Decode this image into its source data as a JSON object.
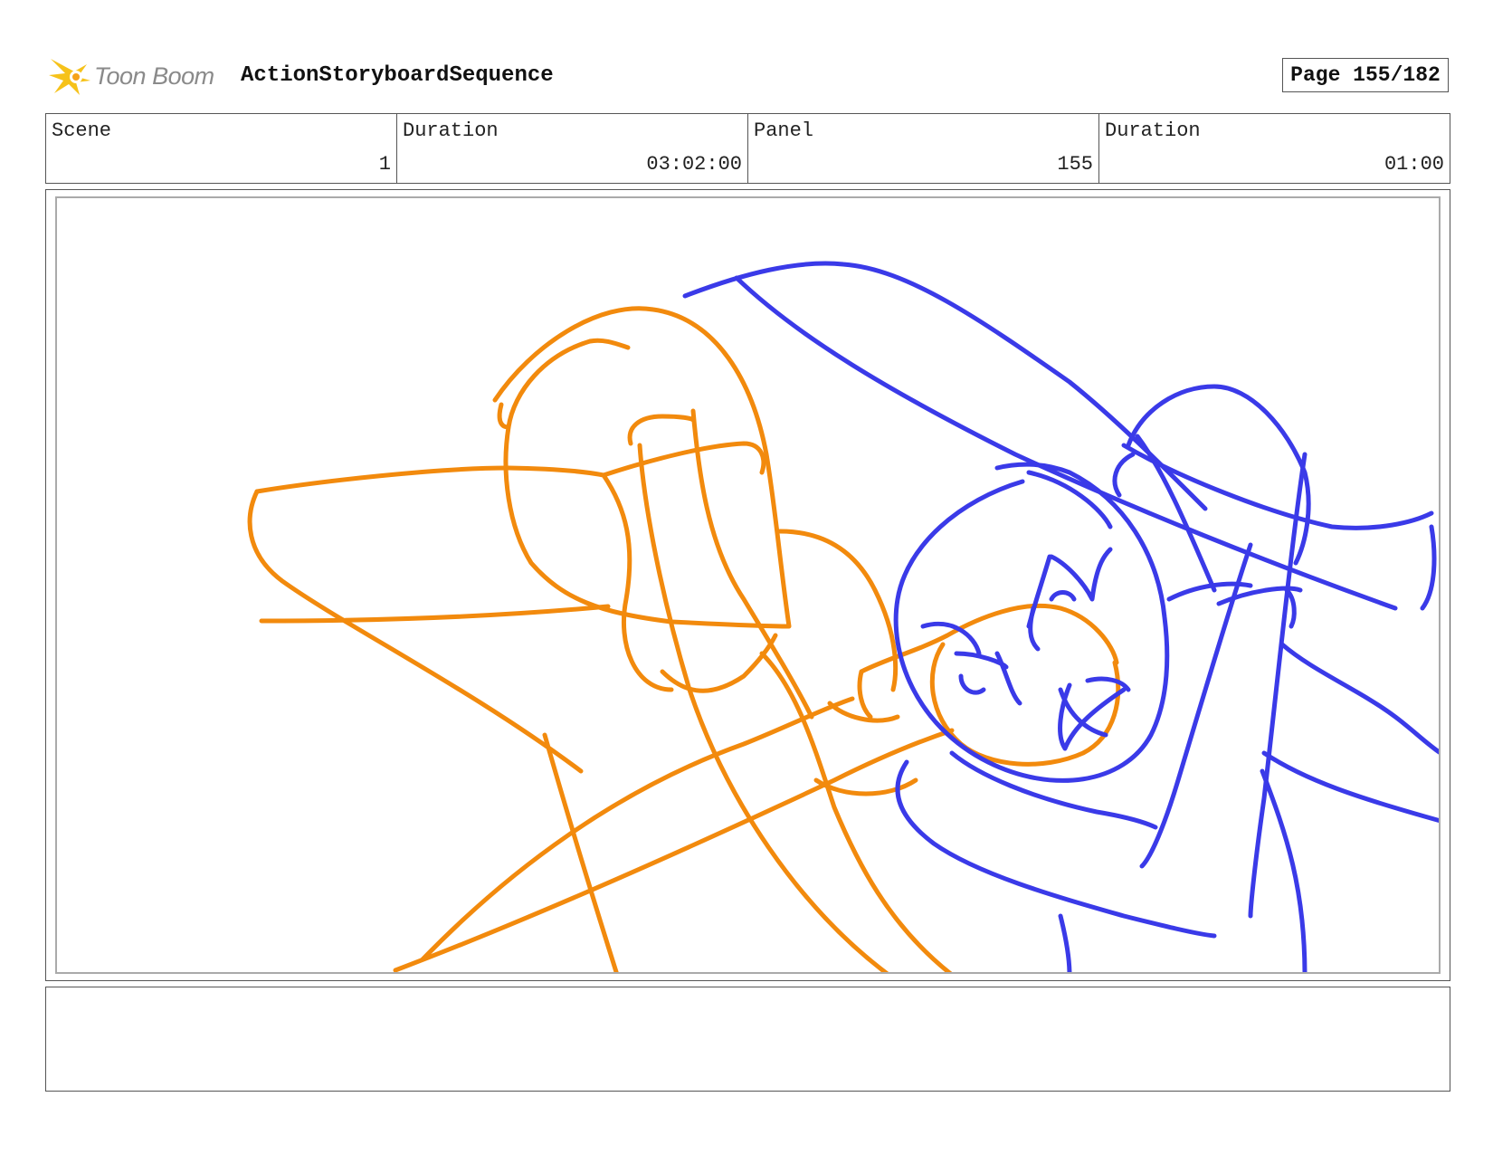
{
  "header": {
    "logo_text": "Toon Boom",
    "logo_icon": "toon-boom-burst-icon",
    "sequence_title": "ActionStoryboardSequence",
    "page_label": "Page 155/182"
  },
  "info": {
    "scene_label": "Scene",
    "scene_value": "1",
    "scene_duration_label": "Duration",
    "scene_duration_value": "03:02:00",
    "panel_label": "Panel",
    "panel_value": "155",
    "panel_duration_label": "Duration",
    "panel_duration_value": "01:00"
  },
  "panel": {
    "sketch_colors": {
      "character_a": "#f28a0d",
      "character_b": "#3a3ae8"
    }
  },
  "notes": {
    "text": ""
  }
}
